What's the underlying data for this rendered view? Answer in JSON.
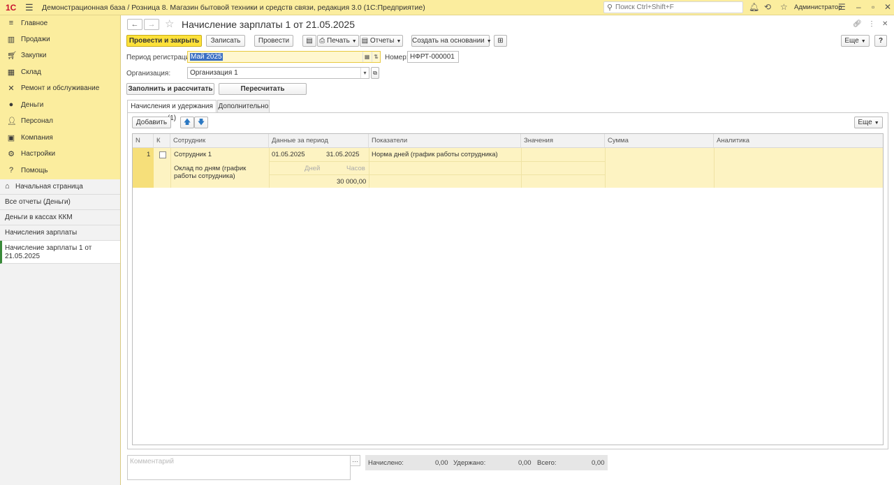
{
  "topbar": {
    "logo": "1С",
    "title": "Демонстрационная база / Розница 8. Магазин бытовой техники и средств связи, редакция 3.0  (1С:Предприятие)",
    "search_placeholder": "Поиск Ctrl+Shift+F",
    "user": "Администратор"
  },
  "sidebar": {
    "items": [
      {
        "label": "Главное",
        "icon": "menu-icon"
      },
      {
        "label": "Продажи",
        "icon": "sales-icon"
      },
      {
        "label": "Закупки",
        "icon": "purchases-icon"
      },
      {
        "label": "Склад",
        "icon": "warehouse-icon"
      },
      {
        "label": "Ремонт и обслуживание",
        "icon": "repair-icon"
      },
      {
        "label": "Деньги",
        "icon": "money-icon"
      },
      {
        "label": "Персонал",
        "icon": "personnel-icon"
      },
      {
        "label": "Компания",
        "icon": "company-icon"
      },
      {
        "label": "Настройки",
        "icon": "settings-icon"
      },
      {
        "label": "Помощь",
        "icon": "help-icon"
      }
    ],
    "open_windows": [
      {
        "label": "Начальная страница"
      },
      {
        "label": "Все отчеты (Деньги)"
      },
      {
        "label": "Деньги в кассах ККМ"
      },
      {
        "label": "Начисления зарплаты"
      },
      {
        "label": "Начисление зарплаты 1 от 21.05.2025"
      }
    ]
  },
  "document": {
    "title": "Начисление зарплаты 1 от 21.05.2025",
    "toolbar": {
      "post_close": "Провести и закрыть",
      "save": "Записать",
      "post": "Провести",
      "print": "Печать",
      "reports": "Отчеты",
      "create_based": "Создать на основании",
      "more": "Еще",
      "help": "?"
    },
    "fields": {
      "period_label": "Период регистрации:",
      "period_value": "Май 2025",
      "number_label": "Номер:",
      "number_value": "НФРТ-000001",
      "org_label": "Организация:",
      "org_value": "Организация 1"
    },
    "actions": {
      "fill": "Заполнить и рассчитать",
      "recalc": "Пересчитать"
    },
    "tabs": [
      {
        "label": "Начисления и удержания (1)"
      },
      {
        "label": "Дополнительно"
      }
    ],
    "table_toolbar": {
      "add": "Добавить",
      "more": "Еще"
    },
    "table": {
      "columns": [
        "N",
        "К",
        "Сотрудник",
        "Данные за период",
        "Показатели",
        "Значения",
        "Сумма",
        "Аналитика"
      ],
      "row": {
        "n": "1",
        "employee": "Сотрудник 1",
        "accrual": "Оклад по дням (график работы сотрудника)",
        "date_from": "01.05.2025",
        "date_to": "31.05.2025",
        "days_label": "Дней",
        "hours_label": "Часов",
        "amount": "30 000,00",
        "indicator": "Норма дней (график работы сотрудника)"
      }
    },
    "footer": {
      "comment_placeholder": "Комментарий",
      "accrued_label": "Начислено:",
      "accrued_value": "0,00",
      "withheld_label": "Удержано:",
      "withheld_value": "0,00",
      "total_label": "Всего:",
      "total_value": "0,00"
    }
  }
}
